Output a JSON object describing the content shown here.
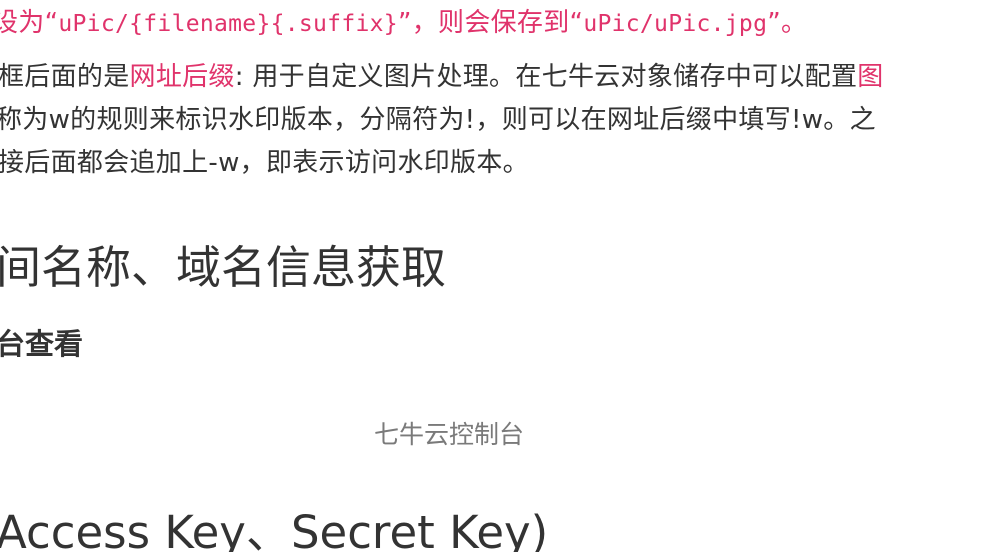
{
  "line1": {
    "prefix": "设为",
    "q1_open": "“",
    "code1": "uPic/{filename}{.suffix}",
    "q1_close": "”，",
    "middle": "则会保存到",
    "q2_open": "“",
    "code2": "uPic/uPic.jpg",
    "q2_close": "”。"
  },
  "line2": {
    "prefix": "框后面的是",
    "label": "网址后缀",
    "rest": ": 用于自定义图片处理。在七牛云对象储存中可以配置",
    "trail": "图"
  },
  "line3": {
    "text": "称为w的规则来标识水印版本，分隔符为!，则可以在网址后缀中填写!w。之"
  },
  "line4": {
    "text": "接后面都会追加上-w，即表示访问水印版本。"
  },
  "heading_bucket": "间名称、域名信息获取",
  "subheading_console": "台查看",
  "image_caption": "七牛云控制台",
  "heading_keys": "Access Key、Secret Key)"
}
